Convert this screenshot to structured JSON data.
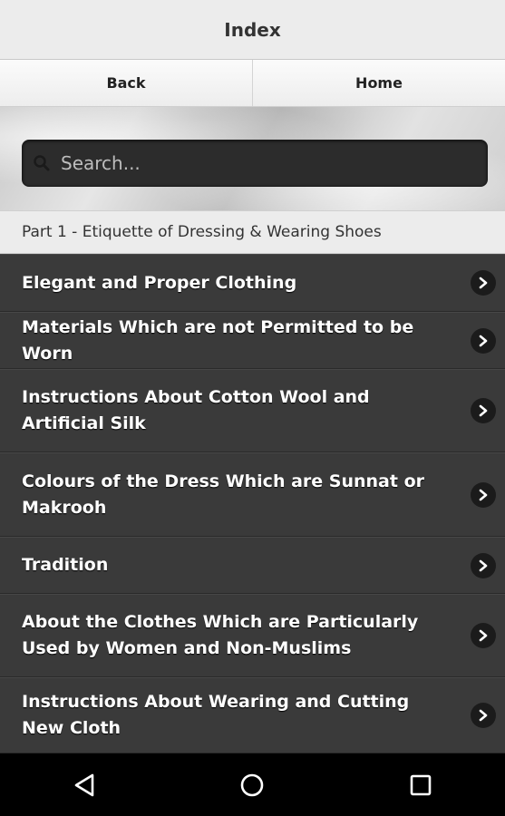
{
  "header": {
    "title": "Index"
  },
  "nav": {
    "back_label": "Back",
    "home_label": "Home"
  },
  "search": {
    "placeholder": "Search...",
    "value": ""
  },
  "section": {
    "title": "Part 1 - Etiquette of Dressing & Wearing Shoes"
  },
  "items": [
    {
      "label": "Elegant and Proper Clothing"
    },
    {
      "label": "Materials Which are not Permitted to be Worn"
    },
    {
      "label": "Instructions About Cotton Wool and Artificial Silk"
    },
    {
      "label": "Colours of the Dress Which are Sunnat or Makrooh"
    },
    {
      "label": "Tradition"
    },
    {
      "label": "About the Clothes Which are Particularly Used by Women and Non-Muslims"
    },
    {
      "label": "Instructions About Wearing and Cutting New Cloth"
    }
  ],
  "icons": {
    "search": "search-icon",
    "chevron": "chevron-right-icon",
    "back": "back-triangle-icon",
    "home": "home-circle-icon",
    "recents": "recents-square-icon"
  },
  "colors": {
    "list_background": "#3a3a3a",
    "header_background": "#ececec",
    "system_bar": "#000000"
  }
}
